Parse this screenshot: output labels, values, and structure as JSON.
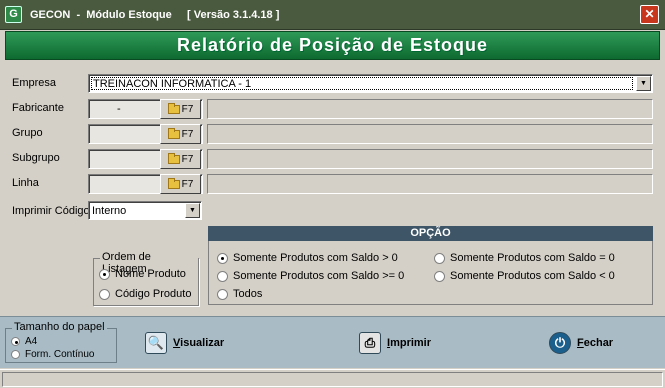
{
  "window": {
    "title": "GECON  -  Módulo Estoque     [ Versão 3.1.4.18 ]",
    "close_symbol": "✕",
    "app_icon_letter": "G"
  },
  "banner": {
    "title": "Relatório de Posição de Estoque"
  },
  "form": {
    "empresa_label": "Empresa",
    "empresa_value": "TREINACON INFORMATICA - 1",
    "fabricante_label": "Fabricante",
    "fabricante_value": "-",
    "grupo_label": "Grupo",
    "subgrupo_label": "Subgrupo",
    "linha_label": "Linha",
    "f7_label": "F7",
    "imprimir_codigo_label": "Imprimir Código",
    "imprimir_codigo_value": "Interno"
  },
  "ordem": {
    "title": "Ordem de Listagem",
    "options": [
      {
        "label": "Nome Produto",
        "selected": true
      },
      {
        "label": "Código Produto",
        "selected": false
      }
    ]
  },
  "opcao": {
    "title": "OPÇÃO",
    "options": [
      {
        "label": "Somente Produtos com Saldo > 0",
        "selected": true
      },
      {
        "label": "Somente Produtos com Saldo >= 0",
        "selected": false
      },
      {
        "label": "Todos",
        "selected": false
      },
      {
        "label": "Somente Produtos com Saldo = 0",
        "selected": false
      },
      {
        "label": "Somente Produtos com Saldo < 0",
        "selected": false
      }
    ]
  },
  "paper": {
    "title": "Tamanho do papel",
    "options": [
      {
        "label": "A4",
        "selected": true
      },
      {
        "label": "Form. Contínuo",
        "selected": false
      }
    ]
  },
  "actions": {
    "visualizar": {
      "accel": "V",
      "rest": "isualizar",
      "icon": "magnifier-icon"
    },
    "imprimir": {
      "accel": "I",
      "rest": "mprimir",
      "icon": "printer-icon"
    },
    "fechar": {
      "accel": "F",
      "rest": "echar",
      "icon": "power-icon"
    }
  },
  "colors": {
    "banner": "#1f8a47",
    "titlebar": "#4a5a3f",
    "bottom_panel": "#a9bcc6",
    "opcao_header": "#3d5566"
  }
}
